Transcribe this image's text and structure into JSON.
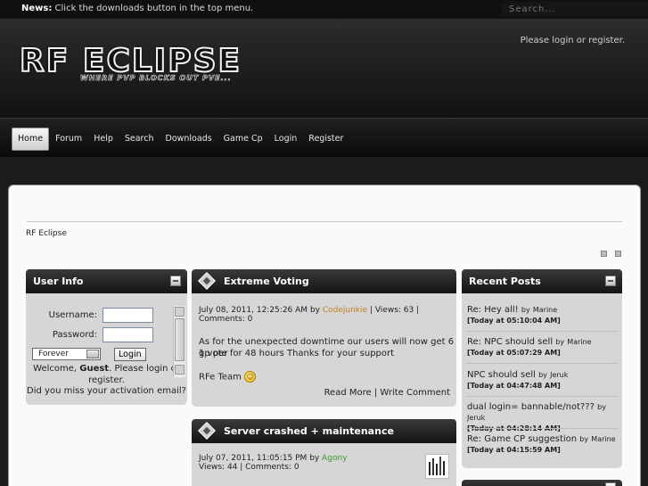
{
  "news": {
    "label": "News:",
    "text": "Click the downloads button in the top menu."
  },
  "search": {
    "placeholder": "Search..."
  },
  "header": {
    "login_text": "Please login or register.",
    "logo_title": "RF ECLIPSE",
    "logo_tagline": "WHERE PVP BLOCKS OUT PVE..."
  },
  "nav": {
    "items": [
      {
        "label": "Home"
      },
      {
        "label": "Forum"
      },
      {
        "label": "Help"
      },
      {
        "label": "Search"
      },
      {
        "label": "Downloads"
      },
      {
        "label": "Game Cp"
      },
      {
        "label": "Login"
      },
      {
        "label": "Register"
      }
    ]
  },
  "breadcrumb": "RF Eclipse",
  "user_info": {
    "title": "User Info",
    "username_label": "Username:",
    "password_label": "Password:",
    "duration": "Forever",
    "login_button": "Login",
    "welcome_prefix": "Welcome,",
    "welcome_guest": "Guest",
    "welcome_suffix": ". Please login or register.",
    "activation": "Did you miss your activation email?"
  },
  "news_posts": [
    {
      "title": "Extreme Voting",
      "date": "July 08, 2011, 12:25:26 AM",
      "by": "by",
      "author": "Codejunkie",
      "stats": "| Views: 63 | Comments: 0",
      "body_line1": "As for the unexpected downtime our users will now get 6 gp per",
      "body_line2": "1 vote for 48 hours Thanks for your support",
      "signature": "RFe Team",
      "read_more": "Read More",
      "separator": "|",
      "write_comment": "Write Comment"
    },
    {
      "title": "Server crashed + maintenance",
      "date": "July 07, 2011, 11:05:15 PM",
      "by": "by",
      "author": "Agony",
      "stats": "Views: 44 | Comments: 0"
    }
  ],
  "recent_posts": {
    "title": "Recent Posts",
    "items": [
      {
        "topic": "Re: Hey all!",
        "by": "by",
        "author": "Marine",
        "time": "[Today at 05:10:04 AM]"
      },
      {
        "topic": "Re: NPC should sell",
        "by": "by",
        "author": "Marine",
        "time": "[Today at 05:07:29 AM]"
      },
      {
        "topic": "NPC should sell",
        "by": "by",
        "author": "Jeruk",
        "time": "[Today at 04:47:48 AM]"
      },
      {
        "topic": "dual login= bannable/not???",
        "by": "by",
        "author": "Jeruk",
        "time": "[Today at 04:28:14 AM]"
      },
      {
        "topic": "Re: Game CP suggestion",
        "by": "by",
        "author": "Marine",
        "time": "[Today at 04:15:59 AM]"
      }
    ]
  }
}
